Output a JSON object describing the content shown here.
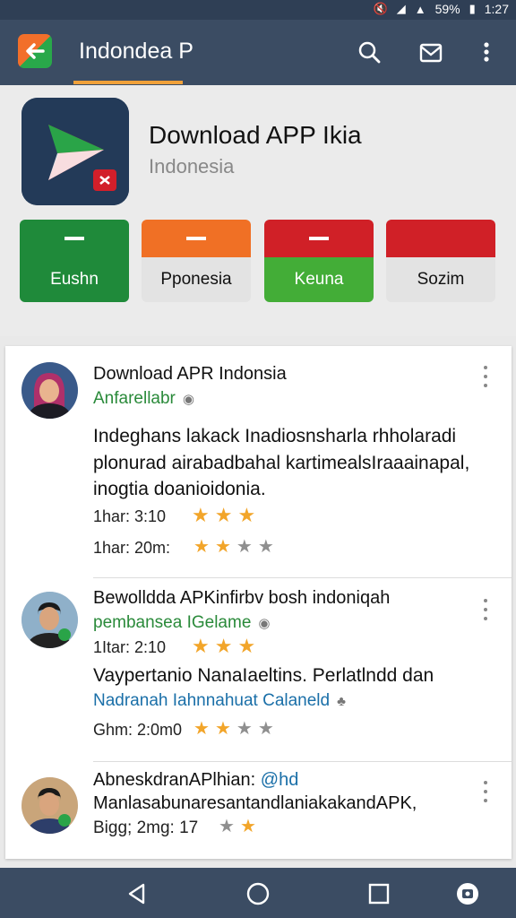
{
  "status_bar": {
    "battery": "59%",
    "time": "1:27"
  },
  "app_bar": {
    "title": "Indondea P",
    "icons": [
      "search-icon",
      "inbox-icon",
      "more-vert-icon"
    ]
  },
  "app": {
    "name": "Download APP Ikia",
    "subtitle": "Indonesia"
  },
  "categories": [
    {
      "label": "Eushn",
      "top_color": "#1f8a3a",
      "bottom_color": "#1f8a3a",
      "text_color": "#ffffff"
    },
    {
      "label": "Pponesia",
      "top_color": "#f07025",
      "bottom_color": "#e3e3e3",
      "text_color": "#111111"
    },
    {
      "label": "Keuna",
      "top_color": "#d02027",
      "bottom_color": "#43ad37",
      "text_color": "#ffffff"
    },
    {
      "label": "Sozim",
      "top_color": "#d02027",
      "bottom_color": "#e3e3e3",
      "text_color": "#111111"
    }
  ],
  "reviews": [
    {
      "title": "Download APR Indonsia",
      "author": "Anfarellabr",
      "body": [
        "Indeghans lakack Inadiosnsharla rhholaradi",
        "plonurad airabadbahal kartimealsIraaainapal,",
        "inogtia doanioidonia."
      ],
      "ratings": [
        {
          "time": "1har: 3:10",
          "stars": 3,
          "filled": 3
        },
        {
          "time": "1har: 20m:",
          "stars": 4,
          "filled": 2
        }
      ]
    },
    {
      "title": "Bewolldda APKinfirbv bosh indoniqah",
      "author": "pembansea IGelame",
      "time": "1Itar: 2:10",
      "stars": 3,
      "filled": 3,
      "body_line": "Vaypertanio NanaIaeltins. Perlatlndd dan",
      "meta_line": "Nadranah Iahnnahuat Calaneld",
      "bottom_time": "Ghm: 2:0m0",
      "bottom_stars": 4,
      "bottom_filled": 2
    },
    {
      "title": "AbneskdranAPlhian:",
      "title_suffix": "@hd",
      "body": "ManlasabunaresantandlaniakakandAPK,",
      "time": "Bigg; 2mg: 17"
    }
  ],
  "nav": [
    "back-triangle-icon",
    "home-circle-icon",
    "recents-square-icon",
    "assistant-icon"
  ]
}
